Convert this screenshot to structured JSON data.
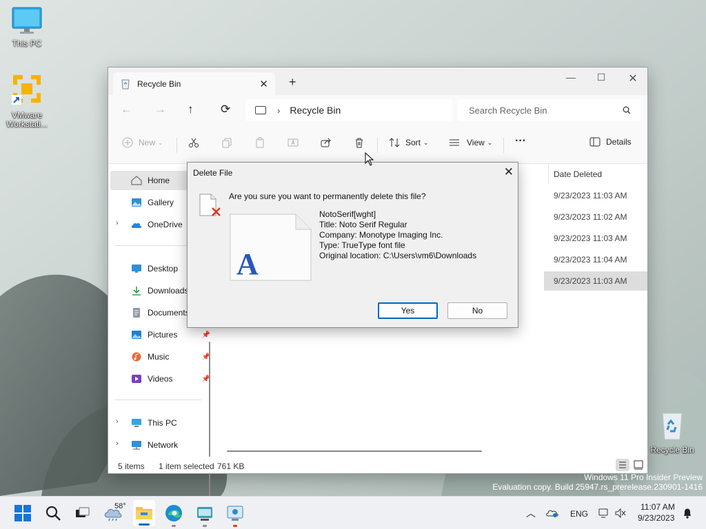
{
  "desktop": {
    "icons": [
      {
        "label": "This PC"
      },
      {
        "label": "VMware Workstati..."
      },
      {
        "label": "Recycle Bin"
      }
    ],
    "watermark": {
      "line1": "Windows 11 Pro Insider Preview",
      "line2": "Evaluation copy. Build 25947.rs_prerelease.230901-1416"
    }
  },
  "explorer": {
    "tab_title": "Recycle Bin",
    "breadcrumb": "Recycle Bin",
    "search_placeholder": "Search Recycle Bin",
    "toolbar": {
      "new_label": "New",
      "sort_label": "Sort",
      "view_label": "View",
      "details_label": "Details"
    },
    "nav_pane": {
      "items": [
        {
          "label": "Home"
        },
        {
          "label": "Gallery"
        },
        {
          "label": "OneDrive"
        },
        {
          "label": "Desktop"
        },
        {
          "label": "Downloads"
        },
        {
          "label": "Documents"
        },
        {
          "label": "Pictures"
        },
        {
          "label": "Music"
        },
        {
          "label": "Videos"
        },
        {
          "label": "This PC"
        },
        {
          "label": "Network"
        }
      ]
    },
    "list": {
      "date_header": "Date Deleted",
      "rows": [
        {
          "date_deleted": "9/23/2023 11:03 AM"
        },
        {
          "date_deleted": "9/23/2023 11:02 AM"
        },
        {
          "date_deleted": "9/23/2023 11:03 AM"
        },
        {
          "date_deleted": "9/23/2023 11:04 AM"
        },
        {
          "date_deleted": "9/23/2023 11:03 AM"
        }
      ]
    },
    "status": {
      "items_count": "5 items",
      "selection": "1 item selected",
      "size": "761 KB"
    }
  },
  "dialog": {
    "title": "Delete File",
    "question": "Are you sure you want to permanently delete this file?",
    "file_name": "NotoSerif[wght]",
    "file_title": "Title: Noto Serif Regular",
    "company": "Company: Monotype Imaging Inc.",
    "type": "Type: TrueType font file",
    "location": "Original location: C:\\Users\\vm6\\Downloads",
    "thumb_letter": "A",
    "yes_label": "Yes",
    "no_label": "No"
  },
  "taskbar": {
    "weather_temp": "58°",
    "language": "ENG",
    "time": "11:07 AM",
    "date": "9/23/2023"
  },
  "colors": {
    "accent": "#0067c0",
    "start_blue": "#1a73d9",
    "folder_yellow": "#f4c443"
  }
}
